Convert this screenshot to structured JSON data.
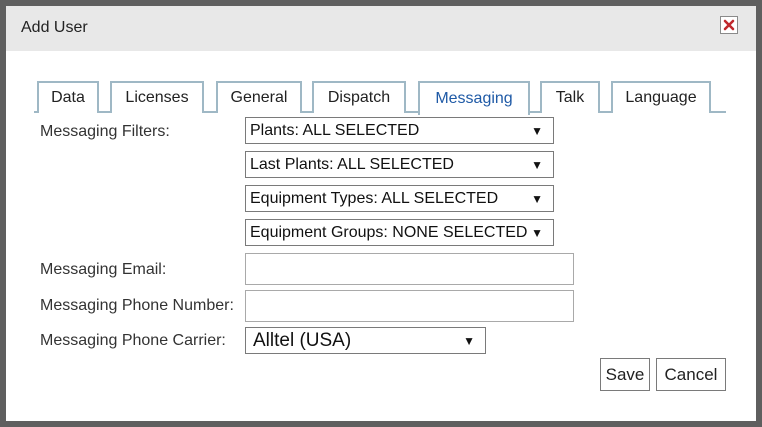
{
  "dialog": {
    "title": "Add User",
    "close_icon": "close-icon",
    "close_color": "#c0282d"
  },
  "tabs": [
    {
      "label": "Data"
    },
    {
      "label": "Licenses"
    },
    {
      "label": "General"
    },
    {
      "label": "Dispatch"
    },
    {
      "label": "Messaging",
      "active": true
    },
    {
      "label": "Talk"
    },
    {
      "label": "Language"
    }
  ],
  "form": {
    "filters_label": "Messaging Filters:",
    "filters": [
      {
        "value": "Plants: ALL SELECTED"
      },
      {
        "value": "Last Plants: ALL SELECTED"
      },
      {
        "value": "Equipment Types: ALL SELECTED"
      },
      {
        "value": "Equipment Groups: NONE SELECTED"
      }
    ],
    "email_label": "Messaging Email:",
    "email_value": "",
    "phone_label": "Messaging Phone Number:",
    "phone_value": "",
    "carrier_label": "Messaging Phone Carrier:",
    "carrier_value": "Alltel (USA)"
  },
  "buttons": {
    "save": "Save",
    "cancel": "Cancel"
  },
  "colors": {
    "active_tab": "#1f5aa6",
    "tab_border": "#9fb8c5",
    "title_bar": "#e8e8e8",
    "frame": "#5f5f5f"
  }
}
